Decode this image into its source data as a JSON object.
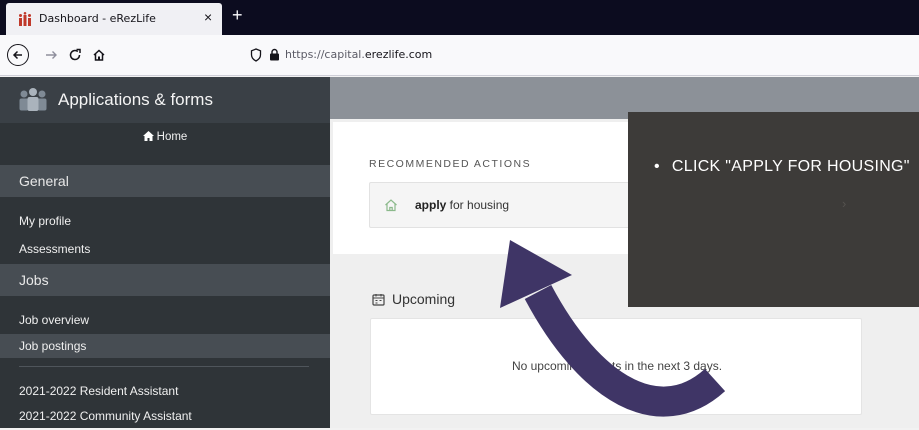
{
  "browser": {
    "tab_title": "Dashboard - eRezLife",
    "tab_close": "×",
    "new_tab": "+",
    "url_prefix": "https://capital.",
    "url_domain": "erezlife.com"
  },
  "sidebar": {
    "title": "Applications & forms",
    "home": "Home",
    "general_header": "General",
    "general_items": [
      "My profile",
      "Assessments"
    ],
    "jobs_header": "Jobs",
    "jobs_items": [
      "Job overview",
      "Job postings"
    ],
    "postings": [
      "2021-2022 Resident Assistant",
      "2021-2022 Community Assistant"
    ]
  },
  "main": {
    "recommended_label": "RECOMMENDED ACTIONS",
    "action_bold": "apply",
    "action_rest": " for housing",
    "upcoming_title": "Upcoming",
    "upcoming_empty": "No upcoming events in the next 3 days."
  },
  "callout": {
    "text": "CLICK \"APPLY FOR HOUSING\"",
    "chevron": "›"
  },
  "colors": {
    "sidebar_bg": "#2f3438",
    "section_bg": "#474d53",
    "callout_bg": "#3d3b39",
    "arrow": "#3f3566",
    "home_icon_green": "#8bb98b"
  }
}
